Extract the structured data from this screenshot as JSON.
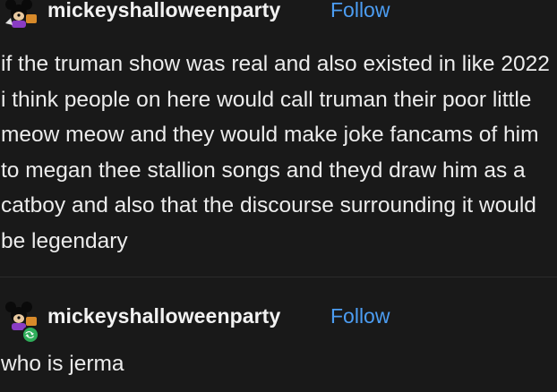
{
  "posts": [
    {
      "username": "mickeyshalloweenparty",
      "follow_label": "Follow",
      "avatar_icon": "mickey-avatar-icon",
      "body": "if the truman show was real and also existed in like 2022 i think people on here would call truman their poor little meow meow and they would make joke fancams of him to megan thee stallion songs and theyd draw him as a catboy and also that the discourse surrounding it would be legendary"
    },
    {
      "username": "mickeyshalloweenparty",
      "follow_label": "Follow",
      "avatar_icon": "mickey-avatar-icon",
      "badge_icon": "reblog-icon",
      "body": "who is jerma"
    }
  ],
  "colors": {
    "background": "#191919",
    "text": "#ececec",
    "link": "#4c9df2",
    "badge": "#2fae5a"
  }
}
